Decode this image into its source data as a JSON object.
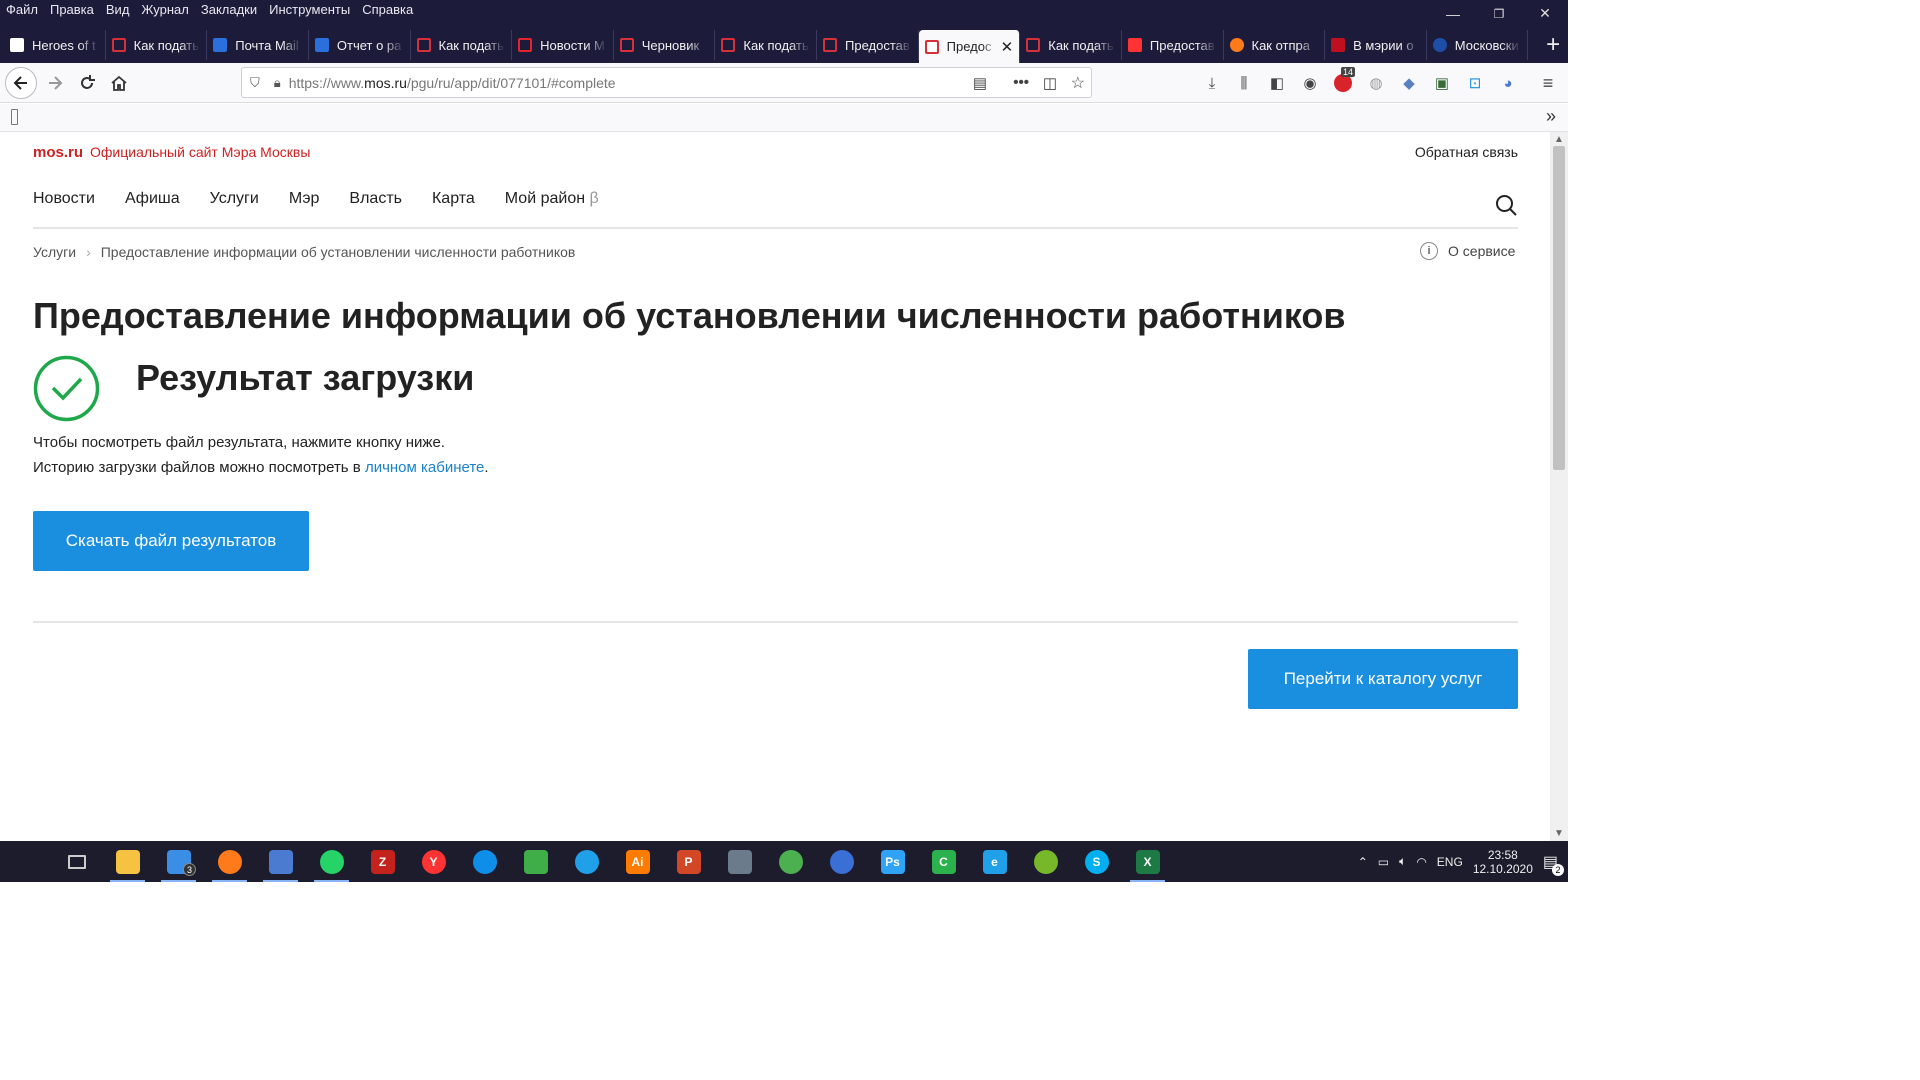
{
  "menu": [
    "Файл",
    "Правка",
    "Вид",
    "Журнал",
    "Закладки",
    "Инструменты",
    "Справка"
  ],
  "window_controls": {
    "minimize": "—",
    "restore": "❐",
    "close": "✕"
  },
  "tabs": [
    {
      "title": "Heroes of t",
      "icon": "wikipedia-icon",
      "color": "#ffffff",
      "active": false
    },
    {
      "title": "Как подать",
      "icon": "page-icon",
      "color": "#d6303a",
      "active": false
    },
    {
      "title": "Почта Mail",
      "icon": "mail-icon",
      "color": "#2a6fdb",
      "active": false
    },
    {
      "title": "Отчет о ра",
      "icon": "mail-icon",
      "color": "#2a6fdb",
      "active": false
    },
    {
      "title": "Как подать",
      "icon": "page-icon",
      "color": "#d6303a",
      "active": false
    },
    {
      "title": "Новости М",
      "icon": "page-icon",
      "color": "#e3242b",
      "active": false
    },
    {
      "title": "Черновик",
      "icon": "page-icon",
      "color": "#d6303a",
      "active": false
    },
    {
      "title": "Как подать",
      "icon": "page-icon",
      "color": "#d6303a",
      "active": false
    },
    {
      "title": "Предостав",
      "icon": "page-icon",
      "color": "#d6303a",
      "active": false
    },
    {
      "title": "Предос",
      "icon": "page-icon",
      "color": "#d6303a",
      "active": true
    },
    {
      "title": "Как подать",
      "icon": "page-icon",
      "color": "#d6303a",
      "active": false
    },
    {
      "title": "Предостав",
      "icon": "yandex-icon",
      "color": "#ff3333",
      "active": false
    },
    {
      "title": "Как отпра",
      "icon": "firefox-icon",
      "color": "#ff7a1a",
      "active": false
    },
    {
      "title": "В мэрии о",
      "icon": "flag-icon",
      "color": "#c01020",
      "active": false
    },
    {
      "title": "Московски",
      "icon": "globe-icon",
      "color": "#1d4fa8",
      "active": false
    }
  ],
  "url": {
    "prefix": "https://www.",
    "domain": "mos.ru",
    "path": "/pgu/ru/app/dit/077101/#complete"
  },
  "addon_badge": "14",
  "site": {
    "logo": "mos.ru",
    "logo_text": "Официальный сайт Мэра Москвы",
    "feedback": "Обратная связь",
    "nav": [
      "Новости",
      "Афиша",
      "Услуги",
      "Мэр",
      "Власть",
      "Карта",
      "Мой район"
    ],
    "nav_beta": "β",
    "breadcrumb": {
      "root": "Услуги",
      "sep": "›",
      "current": "Предоставление информации об установлении численности работников"
    },
    "about": "О сервисе",
    "about_icon": "i",
    "title": "Предоставление информации об установлении численности работников",
    "result_title": "Результат загрузки",
    "text1": "Чтобы посмотреть файл результата, нажмите кнопку ниже.",
    "text2_before": "Историю загрузки файлов можно посмотреть в ",
    "text2_link": "личном кабинете",
    "text2_after": ".",
    "download_button": "Скачать файл результатов",
    "catalog_button": "Перейти к каталогу услуг",
    "accent_color": "#1a8fe0",
    "success_color": "#1ea84a"
  },
  "taskbar": {
    "apps": [
      {
        "name": "start-icon",
        "color": "#ffffff",
        "label": ""
      },
      {
        "name": "task-view-icon",
        "color": "#cccccc",
        "label": ""
      },
      {
        "name": "explorer-icon",
        "color": "#f5c242",
        "label": ""
      },
      {
        "name": "mail-icon",
        "color": "#3a8ee6",
        "label": "",
        "badge": "3"
      },
      {
        "name": "firefox-icon",
        "color": "#ff7a1a",
        "label": ""
      },
      {
        "name": "remote-icon",
        "color": "#4a7bd0",
        "label": ""
      },
      {
        "name": "whatsapp-icon",
        "color": "#25d366",
        "label": ""
      },
      {
        "name": "filezilla-icon",
        "color": "#c3221d",
        "label": "Z"
      },
      {
        "name": "yandex-icon",
        "color": "#ff3333",
        "label": "Y"
      },
      {
        "name": "teamviewer-icon",
        "color": "#0e8ee9",
        "label": ""
      },
      {
        "name": "map-icon",
        "color": "#3fae49",
        "label": ""
      },
      {
        "name": "edge-icon",
        "color": "#1fa0e8",
        "label": ""
      },
      {
        "name": "illustrator-icon",
        "color": "#ff7c00",
        "label": "Ai"
      },
      {
        "name": "powerpoint-icon",
        "color": "#d24726",
        "label": "P"
      },
      {
        "name": "calculator-icon",
        "color": "#6b7b8c",
        "label": ""
      },
      {
        "name": "chrome-icon",
        "color": "#4caf50",
        "label": ""
      },
      {
        "name": "browser-icon",
        "color": "#3a6fd6",
        "label": ""
      },
      {
        "name": "photoshop-icon",
        "color": "#2fa3f7",
        "label": "Ps"
      },
      {
        "name": "camtasia-icon",
        "color": "#2bb24c",
        "label": "C"
      },
      {
        "name": "ie-icon",
        "color": "#1fa0e8",
        "label": "e"
      },
      {
        "name": "utorrent-icon",
        "color": "#76b82a",
        "label": ""
      },
      {
        "name": "skype-icon",
        "color": "#00aff0",
        "label": "S"
      },
      {
        "name": "excel-icon",
        "color": "#1d7a45",
        "label": "X"
      }
    ],
    "lang": "ENG",
    "time": "23:58",
    "date": "12.10.2020",
    "notifications": "2"
  }
}
